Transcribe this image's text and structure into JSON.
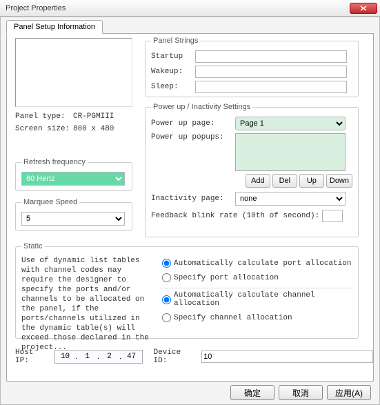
{
  "titlebar": {
    "title": "Project Properties"
  },
  "tab": {
    "label": "Panel Setup Information"
  },
  "left": {
    "panel_type_label": "Panel type:",
    "panel_type_value": "CR-PGMIII",
    "screen_size_label": "Screen size:",
    "screen_size_value": "800 x 480",
    "refresh_group": "Refresh frequency",
    "refresh_value": "60 Hertz",
    "marquee_group": "Marquee Speed",
    "marquee_value": "5"
  },
  "strings": {
    "group": "Panel Strings",
    "startup_label": "Startup",
    "startup_value": "",
    "wakeup_label": "Wakeup:",
    "wakeup_value": "",
    "sleep_label": "Sleep:",
    "sleep_value": ""
  },
  "power": {
    "group": "Power up / Inactivity Settings",
    "page_label": "Power up page:",
    "page_value": "Page 1",
    "popups_label": "Power up popups:",
    "btn_add": "Add",
    "btn_del": "Del",
    "btn_up": "Up",
    "btn_down": "Down",
    "inactivity_label": "Inactivity page:",
    "inactivity_value": "none",
    "blink_label": "Feedback blink rate (10th of second):",
    "blink_value": ""
  },
  "static": {
    "group": "Static",
    "text": "Use of dynamic list tables with channel codes may require the designer to specify the ports and/or channels to be allocated on the panel, if the ports/channels utilized in the dynamic table(s) will exceed those declared in the project...",
    "r1": "Automatically calculate port allocation",
    "r2": "Specify port allocation",
    "r3": "Automatically calculate channel allocation",
    "r4": "Specify channel allocation"
  },
  "bottom": {
    "hostip_label": "Host IP:",
    "ip": {
      "a": "10",
      "b": "1",
      "c": "2",
      "d": "47"
    },
    "deviceid_label": "Device ID:",
    "deviceid_value": "10"
  },
  "footer": {
    "ok": "确定",
    "cancel": "取消",
    "apply": "应用(A)"
  }
}
